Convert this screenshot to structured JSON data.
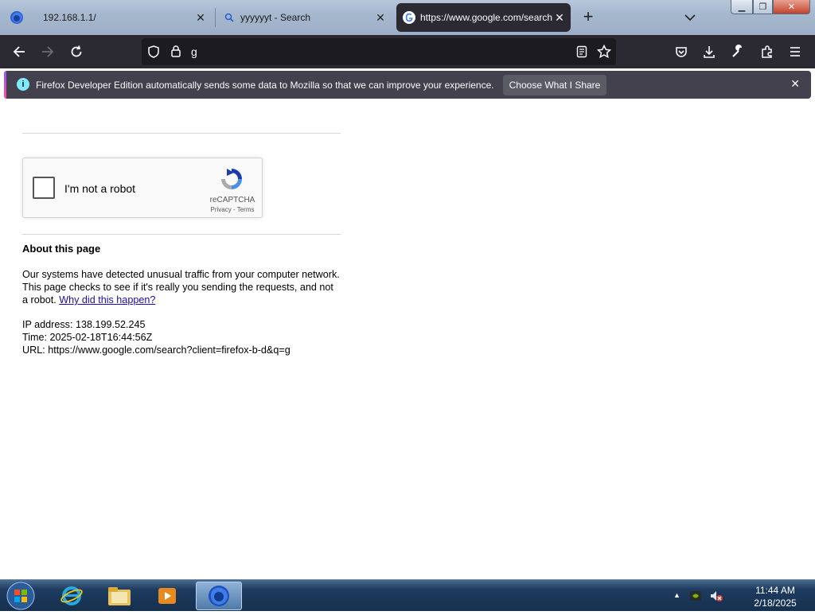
{
  "browser": {
    "tabs": [
      {
        "label": "192.168.1.1/",
        "active": false
      },
      {
        "label": "yyyyyyt - Search",
        "active": false
      },
      {
        "label": "https://www.google.com/search?client=firefox-b-d&q=g",
        "active": true
      }
    ],
    "new_tab_label": "+",
    "url": "g",
    "notification": {
      "message": "Firefox Developer Edition automatically sends some data to Mozilla so that we can improve your experience.",
      "button": "Choose What I Share"
    }
  },
  "page": {
    "captcha": {
      "label": "I'm not a robot",
      "brand": "reCAPTCHA",
      "links": "Privacy - Terms"
    },
    "about_title": "About this page",
    "about_text": "Our systems have detected unusual traffic from your computer network. This page checks to see if it's really you sending the requests, and not a robot.",
    "why_link": "Why did this happen?",
    "ip_line": "IP address: 138.199.52.245",
    "time_line": "Time: 2025-02-18T16:44:56Z",
    "url_line": "URL: https://www.google.com/search?client=firefox-b-d&q=g"
  },
  "taskbar": {
    "time": "11:44 AM",
    "date": "2/18/2025"
  },
  "colors": {
    "toolbar": "#2b2a33",
    "urlbar": "#1c1b22",
    "link": "#1a0dab"
  }
}
